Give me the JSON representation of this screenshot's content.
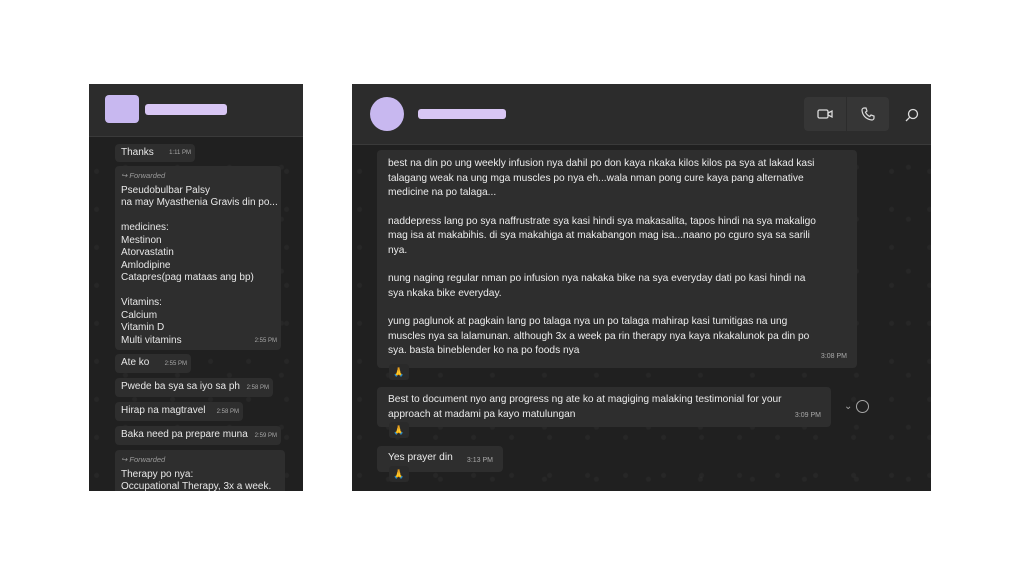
{
  "left_chat": {
    "messages": [
      {
        "text": "Thanks",
        "time": "1:11 PM"
      },
      {
        "forwarded": "Forwarded",
        "lines": [
          "Pseudobulbar Palsy",
          "na may Myasthenia Gravis din po...",
          "",
          "medicines:",
          "Mestinon",
          "Atorvastatin",
          "Amlodipine",
          "Catapres(pag mataas ang bp)",
          "",
          "Vitamins:",
          "Calcium",
          "Vitamin D",
          "Multi vitamins"
        ],
        "time": "2:55 PM"
      },
      {
        "text": "Ate ko",
        "time": "2:55 PM"
      },
      {
        "text": "Pwede ba sya sa iyo sa ph",
        "time": "2:58 PM"
      },
      {
        "text": "Hirap na magtravel",
        "time": "2:58 PM"
      },
      {
        "text": "Baka need pa prepare muna",
        "time": "2:59 PM"
      },
      {
        "forwarded": "Forwarded",
        "lines": [
          "Therapy po nya:",
          "Occupational Therapy, 3x a week."
        ]
      }
    ]
  },
  "right_chat": {
    "header": {
      "video_icon": "video-camera-icon",
      "call_icon": "phone-icon",
      "search_icon": "search-icon"
    },
    "message1": {
      "paragraphs": [
        [
          "best na din po ung weekly infusion nya dahil po don kaya nkaka kilos kilos pa sya at lakad kasi",
          "talagang weak na ung mga muscles po nya eh...wala nman pong cure kaya pang alternative",
          "medicine na po talaga..."
        ],
        [
          "naddepress lang po sya naffrustrate sya kasi hindi sya makasalita, tapos hindi na sya makaligo",
          "mag isa at makabihis. di sya makahiga at makabangon mag isa...naano po cguro sya sa sarili",
          "nya."
        ],
        [
          "nung naging regular nman po infusion nya nakaka bike na sya everyday dati po kasi hindi na",
          "sya nkaka bike everyday."
        ],
        [
          "yung paglunok at pagkain lang po talaga nya un po talaga mahirap kasi tumitigas na ung",
          "muscles nya sa lalamunan. although 3x a week pa rin therapy nya kaya nkakalunok pa din po",
          "sya. basta bineblender ko na po foods nya"
        ]
      ],
      "time": "3:08 PM",
      "reaction": "🙏"
    },
    "message2": {
      "lines": [
        "Best to document nyo ang progress ng ate ko at magiging malaking testimonial for your",
        "approach at madami pa kayo matulungan"
      ],
      "time": "3:09 PM",
      "reaction": "🙏"
    },
    "message3": {
      "text": "Yes prayer din",
      "time": "3:13 PM",
      "reaction": "🙏"
    }
  }
}
